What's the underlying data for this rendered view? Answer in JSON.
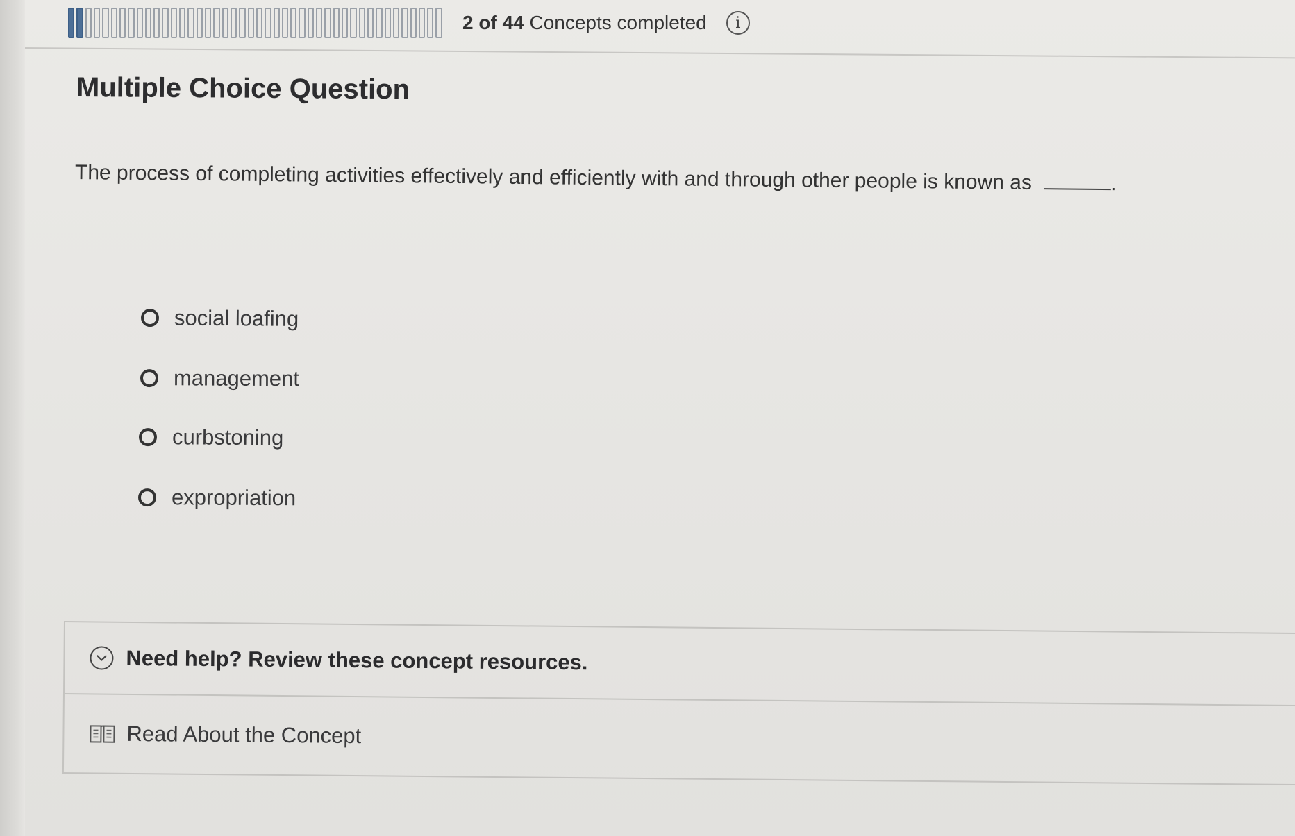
{
  "progress": {
    "completed": 2,
    "total": 44,
    "count_text": "2 of 44",
    "suffix_text": "Concepts completed"
  },
  "icons": {
    "info": "info-icon",
    "expand": "chevron-down-circle-icon",
    "book": "book-icon"
  },
  "question": {
    "heading": "Multiple Choice Question",
    "prompt": "The process of completing activities effectively and efficiently with and through other people is known as",
    "end_punctuation": "."
  },
  "options": [
    {
      "label": "social loafing"
    },
    {
      "label": "management"
    },
    {
      "label": "curbstoning"
    },
    {
      "label": "expropriation"
    }
  ],
  "help": {
    "toggle_label": "Need help? Review these concept resources.",
    "resource_label": "Read About the Concept"
  },
  "colors": {
    "progress_done": "#4d6f97",
    "text": "#2f2f31",
    "background": "#e6e5e2"
  }
}
